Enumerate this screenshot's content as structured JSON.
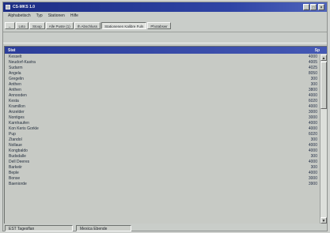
{
  "window": {
    "title": "CS-MKS 1.0"
  },
  "menu": [
    "Alphabetisch",
    "Typ",
    "Stationen",
    "Hilfe"
  ],
  "toolbar": {
    "buttons": [
      {
        "label": "←",
        "active": false
      },
      {
        "label": "Lsto",
        "active": false
      },
      {
        "label": "Stoop",
        "active": false
      },
      {
        "label": "Alle Puste (1)",
        "active": false
      },
      {
        "label": "Ih Abschluss",
        "active": false
      },
      {
        "label": "Stationenen Kalibre Fuln",
        "active": true
      },
      {
        "label": "Photabswr",
        "active": false
      }
    ]
  },
  "list": {
    "header_name": "Stat",
    "header_value": "Sp",
    "rows": [
      {
        "name": "Kesselt",
        "value": "4000"
      },
      {
        "name": "Neudorf-Kastra",
        "value": "4005"
      },
      {
        "name": "Sudarm",
        "value": "4025"
      },
      {
        "name": "Angela",
        "value": "8050"
      },
      {
        "name": "Gregelin",
        "value": "300"
      },
      {
        "name": "Anthen",
        "value": "300"
      },
      {
        "name": "Anthen",
        "value": "3800"
      },
      {
        "name": "Annooden",
        "value": "4000"
      },
      {
        "name": "Kesta",
        "value": "6020"
      },
      {
        "name": "Kramillon",
        "value": "4000"
      },
      {
        "name": "Anzelder",
        "value": "3000"
      },
      {
        "name": "Nontiges",
        "value": "3000"
      },
      {
        "name": "Karnhaufen",
        "value": "4000"
      },
      {
        "name": "Kon Keris Gorkle",
        "value": "4000"
      },
      {
        "name": "Pup",
        "value": "6020"
      },
      {
        "name": "Ztandol",
        "value": "300"
      },
      {
        "name": "Nollaue",
        "value": "4000"
      },
      {
        "name": "Kongbaldo",
        "value": "4000"
      },
      {
        "name": "Budsdalle",
        "value": "300"
      },
      {
        "name": "Dell Deeres",
        "value": "4000"
      },
      {
        "name": "Barkeiir",
        "value": "300"
      },
      {
        "name": "Beple",
        "value": "4000"
      },
      {
        "name": "Bonse",
        "value": "3000"
      },
      {
        "name": "Baeniorde",
        "value": "3900"
      }
    ]
  },
  "status": {
    "left": "EST Tagesflan",
    "right": "Mexica Ebende"
  }
}
